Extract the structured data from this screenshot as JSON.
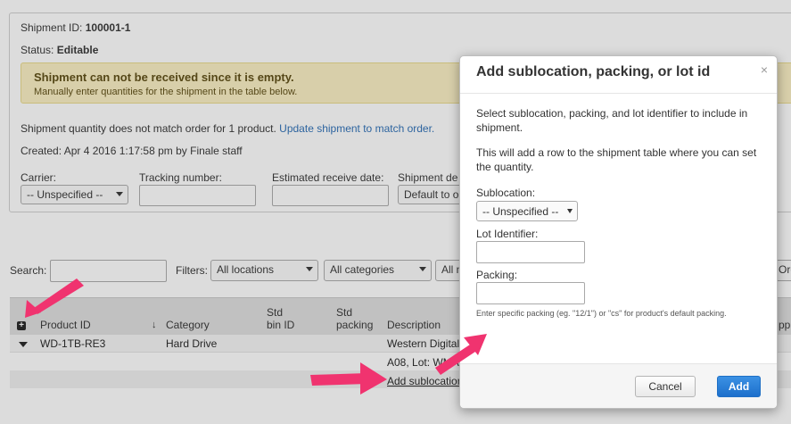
{
  "shipment": {
    "id_label": "Shipment ID:",
    "id_value": "100001-1",
    "status_label": "Status:",
    "status_value": "Editable",
    "warning_title": "Shipment can not be received since it is empty.",
    "warning_body": "Manually enter quantities for the shipment in the table below.",
    "mismatch_text": "Shipment quantity does not match order for 1 product.",
    "mismatch_link": "Update shipment to match order.",
    "created": "Created: Apr 4 2016 1:17:58 pm by Finale staff",
    "carrier_label": "Carrier:",
    "carrier_value": "-- Unspecified --",
    "tracking_label": "Tracking number:",
    "est_receive_label": "Estimated receive date:",
    "ship_date_label": "Shipment de",
    "ship_date_value": "Default to o"
  },
  "filters": {
    "search_label": "Search:",
    "filters_label": "Filters:",
    "locations": "All locations",
    "categories": "All categories",
    "third": "All n",
    "right_partial": "Ord"
  },
  "table": {
    "headers": {
      "product_id": "Product ID",
      "category": "Category",
      "std_bin_1": "Std",
      "std_bin_2": "bin ID",
      "std_pack_1": "Std",
      "std_pack_2": "packing",
      "description": "Description",
      "right_partial": "ppr"
    },
    "row1": {
      "product_id": "WD-1TB-RE3",
      "category": "Hard Drive",
      "description": "Western Digital"
    },
    "row2": {
      "description": "A08, Lot: WMAT"
    },
    "row3": {
      "link": "Add sublocation"
    }
  },
  "modal": {
    "title": "Add sublocation, packing, or lot id",
    "close": "×",
    "intro": "Select sublocation, packing, and lot identifier to include in shipment.",
    "intro2": "This will add a row to the shipment table where you can set the quantity.",
    "sublocation_label": "Sublocation:",
    "sublocation_value": "-- Unspecified --",
    "lot_label": "Lot Identifier:",
    "packing_label": "Packing:",
    "packing_help": "Enter specific packing (eg. \"12/1\") or \"cs\" for product's default packing.",
    "cancel": "Cancel",
    "add": "Add"
  },
  "colors": {
    "arrow": "#f0336f",
    "primary_button": "#1d6fcb",
    "warning_bg": "#faf0c2"
  }
}
